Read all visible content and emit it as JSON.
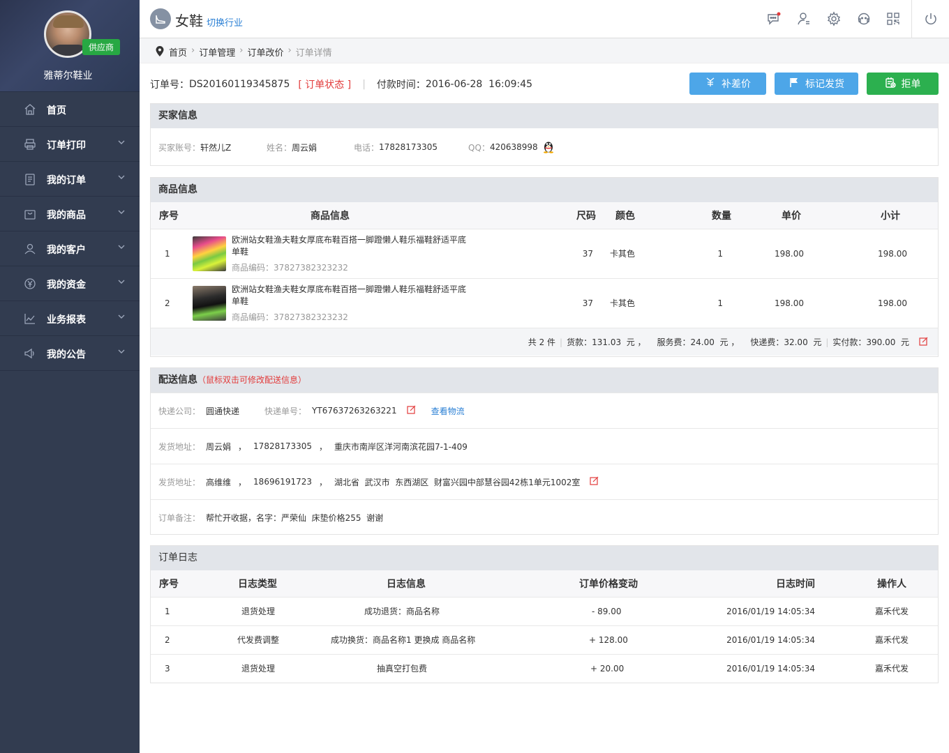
{
  "profile": {
    "shop_name": "雅蒂尔鞋业",
    "badge": "供应商"
  },
  "nav": [
    {
      "label": "首页",
      "icon": "home-icon"
    },
    {
      "label": "订单打印",
      "icon": "printer-icon"
    },
    {
      "label": "我的订单",
      "icon": "clipboard-icon"
    },
    {
      "label": "我的商品",
      "icon": "bag-icon"
    },
    {
      "label": "我的客户",
      "icon": "user-icon"
    },
    {
      "label": "我的资金",
      "icon": "yen-icon"
    },
    {
      "label": "业务报表",
      "icon": "chart-icon"
    },
    {
      "label": "我的公告",
      "icon": "speaker-icon"
    }
  ],
  "topbar": {
    "industry": "女鞋",
    "switch_label": "切换行业"
  },
  "breadcrumb": [
    "首页",
    "订单管理",
    "订单改价",
    "订单详情"
  ],
  "order": {
    "no_label": "订单号：",
    "no": "DS20160119345875",
    "status": "[ 订单状态 ]",
    "pay_time_label": "付款时间：",
    "pay_time": "2016-06-28  16:09:45"
  },
  "buttons": {
    "supplement": "补差价",
    "mark_ship": "标记发货",
    "reject": "拒单"
  },
  "buyer": {
    "title": "买家信息",
    "account_label": "买家账号：",
    "account": "轩然儿Z",
    "name_label": "姓名：",
    "name": "周云娟",
    "phone_label": "电话：",
    "phone": "17828173305",
    "qq_label": "QQ：",
    "qq": "420638998"
  },
  "goods": {
    "title": "商品信息",
    "headers": [
      "序号",
      "商品信息",
      "尺码",
      "颜色",
      "数量",
      "单价",
      "小计"
    ],
    "rows": [
      {
        "no": "1",
        "title": "欧洲站女鞋渔夫鞋女厚底布鞋百搭一脚蹬懒人鞋乐福鞋舒适平底单鞋",
        "code": "商品编码：37827382323232",
        "size": "37",
        "color": "卡其色",
        "qty": "1",
        "price": "198.00",
        "subtotal": "198.00"
      },
      {
        "no": "2",
        "title": "欧洲站女鞋渔夫鞋女厚底布鞋百搭一脚蹬懒人鞋乐福鞋舒适平底单鞋",
        "code": "商品编码：37827382323232",
        "size": "37",
        "color": "卡其色",
        "qty": "1",
        "price": "198.00",
        "subtotal": "198.00"
      }
    ],
    "summary": {
      "count": "共 2 件",
      "goods_fee": "货款：131.03  元 ，",
      "service_fee": "服务费：24.00  元 ，",
      "express_fee": "快递费：32.00  元",
      "paid": "实付款：390.00  元"
    }
  },
  "shipping": {
    "title": "配送信息",
    "tip": "（鼠标双击可修改配送信息）",
    "company_label": "快递公司：",
    "company": "圆通快递",
    "tracking_label": "快递单号：",
    "tracking": "YT67637263263221",
    "track_link": "查看物流",
    "sender_label": "发货地址：",
    "sender_name": "周云娟",
    "sender_phone": "17828173305",
    "sender_addr": "重庆市南岸区洋河南滨花园7-1-409",
    "receiver_label": "发货地址：",
    "receiver_name": "高维维",
    "receiver_phone": "18696191723",
    "receiver_addr": "湖北省  武汉市  东西湖区  财富兴园中部慧谷园42栋1单元1002室",
    "sep": "，",
    "remark_label": "订单备注：",
    "remark": "帮忙开收据，名字：严荣仙  床垫价格255  谢谢"
  },
  "log": {
    "title": "订单日志",
    "headers": [
      "序号",
      "日志类型",
      "日志信息",
      "订单价格变动",
      "日志时间",
      "操作人"
    ],
    "rows": [
      {
        "no": "1",
        "type": "退货处理",
        "info": "成功退货：商品名称",
        "change": "- 89.00",
        "time": "2016/01/19 14:05:34",
        "op": "嘉禾代发"
      },
      {
        "no": "2",
        "type": "代发费调整",
        "info": "成功换货：商品名称1 更换成 商品名称",
        "change": "+ 128.00",
        "time": "2016/01/19 14:05:34",
        "op": "嘉禾代发"
      },
      {
        "no": "3",
        "type": "退货处理",
        "info": "抽真空打包费",
        "change": "+ 20.00",
        "time": "2016/01/19 14:05:34",
        "op": "嘉禾代发"
      }
    ]
  }
}
